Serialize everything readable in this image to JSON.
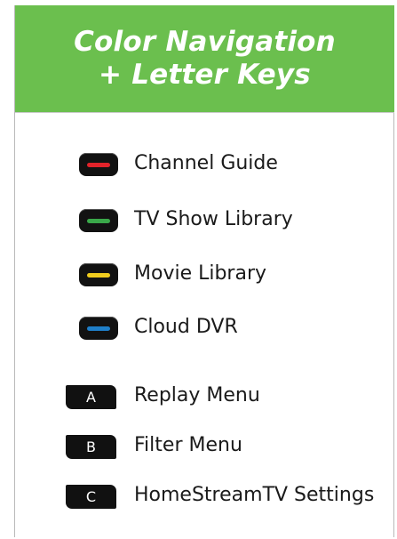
{
  "header": {
    "line1": "Color Navigation",
    "line2": "+ Letter Keys",
    "color": "#6bbf4e"
  },
  "color_keys": [
    {
      "label": "Channel Guide",
      "color": "#e2232a"
    },
    {
      "label": "TV Show Library",
      "color": "#3aa84a"
    },
    {
      "label": "Movie Library",
      "color": "#f0cc1e"
    },
    {
      "label": "Cloud DVR",
      "color": "#1f7fc9"
    }
  ],
  "letter_keys": [
    {
      "key": "A",
      "label": "Replay Menu"
    },
    {
      "key": "B",
      "label": "Filter Menu"
    },
    {
      "key": "C",
      "label": "HomeStreamTV Settings"
    }
  ]
}
